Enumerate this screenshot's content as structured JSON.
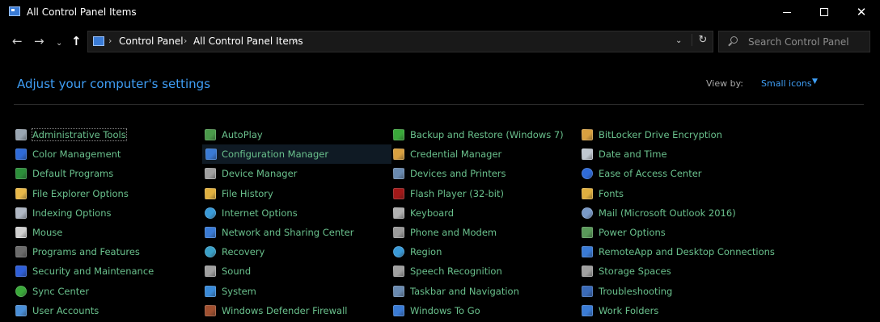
{
  "window": {
    "title": "All Control Panel Items",
    "minimize_glyph": "",
    "close_glyph": "✕"
  },
  "nav": {
    "back_glyph": "←",
    "forward_glyph": "→",
    "recent_glyph": "⌄",
    "up_glyph": "↑",
    "dropdown_glyph": "⌄",
    "refresh_glyph": "↻",
    "separator": "›"
  },
  "address": {
    "crumbs": [
      "Control Panel",
      "All Control Panel Items"
    ]
  },
  "search": {
    "placeholder": "Search Control Panel",
    "value": ""
  },
  "content": {
    "heading": "Adjust your computer's settings",
    "view_by_label": "View by:",
    "view_by_value": "Small icons",
    "view_by_arrow": "▼"
  },
  "colors": {
    "link_green": "#6ac18d",
    "link_blue": "#3f9ef5",
    "background": "#000000"
  },
  "columns": [
    [
      {
        "label": "Administrative Tools",
        "icon": "admin-tools-icon",
        "color": "#9aa6b2"
      },
      {
        "label": "Color Management",
        "icon": "color-management-icon",
        "color": "#2f6bd8"
      },
      {
        "label": "Default Programs",
        "icon": "default-programs-icon",
        "color": "#2c8f3a"
      },
      {
        "label": "File Explorer Options",
        "icon": "folder-options-icon",
        "color": "#e8b84a"
      },
      {
        "label": "Indexing Options",
        "icon": "indexing-options-icon",
        "color": "#b0b8c4"
      },
      {
        "label": "Mouse",
        "icon": "mouse-icon",
        "color": "#d0d0d0"
      },
      {
        "label": "Programs and Features",
        "icon": "programs-features-icon",
        "color": "#6b6b6b"
      },
      {
        "label": "Security and Maintenance",
        "icon": "security-flag-icon",
        "color": "#2f5fd8"
      },
      {
        "label": "Sync Center",
        "icon": "sync-center-icon",
        "color": "#3aa83a"
      },
      {
        "label": "User Accounts",
        "icon": "user-accounts-icon",
        "color": "#4a8fd8"
      }
    ],
    [
      {
        "label": "AutoPlay",
        "icon": "autoplay-icon",
        "color": "#4a9a4a"
      },
      {
        "label": "Configuration Manager",
        "icon": "configuration-manager-icon",
        "color": "#3a7bd5"
      },
      {
        "label": "Device Manager",
        "icon": "device-manager-icon",
        "color": "#a0a0a0"
      },
      {
        "label": "File History",
        "icon": "file-history-icon",
        "color": "#e0b040"
      },
      {
        "label": "Internet Options",
        "icon": "internet-options-icon",
        "color": "#3a9ad8"
      },
      {
        "label": "Network and Sharing Center",
        "icon": "network-sharing-icon",
        "color": "#3a7bd5"
      },
      {
        "label": "Recovery",
        "icon": "recovery-icon",
        "color": "#3aa0c8"
      },
      {
        "label": "Sound",
        "icon": "sound-icon",
        "color": "#a0a0a0"
      },
      {
        "label": "System",
        "icon": "system-icon",
        "color": "#3a8ad8"
      },
      {
        "label": "Windows Defender Firewall",
        "icon": "firewall-icon",
        "color": "#a05030"
      }
    ],
    [
      {
        "label": "Backup and Restore (Windows 7)",
        "icon": "backup-restore-icon",
        "color": "#3aa83a"
      },
      {
        "label": "Credential Manager",
        "icon": "credential-manager-icon",
        "color": "#d8a040"
      },
      {
        "label": "Devices and Printers",
        "icon": "devices-printers-icon",
        "color": "#6a8ab0"
      },
      {
        "label": "Flash Player (32-bit)",
        "icon": "flash-player-icon",
        "color": "#a01818"
      },
      {
        "label": "Keyboard",
        "icon": "keyboard-icon",
        "color": "#b0b0b0"
      },
      {
        "label": "Phone and Modem",
        "icon": "phone-modem-icon",
        "color": "#9a9a9a"
      },
      {
        "label": "Region",
        "icon": "region-icon",
        "color": "#3a9ad8"
      },
      {
        "label": "Speech Recognition",
        "icon": "microphone-icon",
        "color": "#a0a0a0"
      },
      {
        "label": "Taskbar and Navigation",
        "icon": "taskbar-icon",
        "color": "#6a8ab0"
      },
      {
        "label": "Windows To Go",
        "icon": "windows-to-go-icon",
        "color": "#3a7bd5"
      }
    ],
    [
      {
        "label": "BitLocker Drive Encryption",
        "icon": "bitlocker-icon",
        "color": "#d8a040"
      },
      {
        "label": "Date and Time",
        "icon": "date-time-icon",
        "color": "#c0c8d0"
      },
      {
        "label": "Ease of Access Center",
        "icon": "ease-of-access-icon",
        "color": "#2f6bd8"
      },
      {
        "label": "Fonts",
        "icon": "fonts-icon",
        "color": "#e0b040"
      },
      {
        "label": "Mail (Microsoft Outlook 2016)",
        "icon": "mail-icon",
        "color": "#7a9ac8"
      },
      {
        "label": "Power Options",
        "icon": "power-options-icon",
        "color": "#5a9a5a"
      },
      {
        "label": "RemoteApp and Desktop Connections",
        "icon": "remoteapp-icon",
        "color": "#3a7bd5"
      },
      {
        "label": "Storage Spaces",
        "icon": "storage-spaces-icon",
        "color": "#a0a0a0"
      },
      {
        "label": "Troubleshooting",
        "icon": "troubleshooting-icon",
        "color": "#3a6ab8"
      },
      {
        "label": "Work Folders",
        "icon": "work-folders-icon",
        "color": "#3a7bd5"
      }
    ]
  ]
}
